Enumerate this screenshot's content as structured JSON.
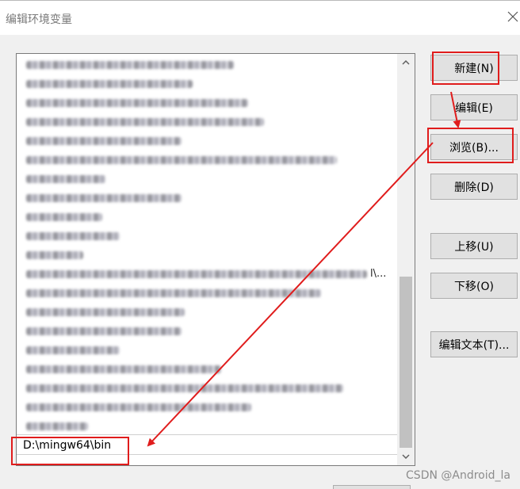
{
  "window": {
    "title": "编辑环境变量"
  },
  "list": {
    "visible_suffix": "l\\...",
    "edit_value": "D:\\mingw64\\bin"
  },
  "buttons": {
    "new": "新建(N)",
    "edit": "编辑(E)",
    "browse": "浏览(B)...",
    "delete": "删除(D)",
    "move_up": "上移(U)",
    "move_down": "下移(O)",
    "edit_text": "编辑文本(T)..."
  },
  "watermark": "CSDN @Android_la",
  "colors": {
    "annotation": "#e01c1c",
    "button_face": "#e1e1e1",
    "scroll_thumb": "#c1c1c1"
  },
  "icons": {
    "close": "close-icon",
    "scroll_up": "chevron-up-icon",
    "scroll_down": "chevron-down-icon"
  }
}
